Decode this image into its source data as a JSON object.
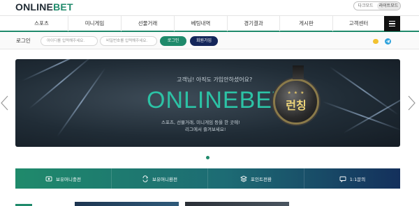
{
  "header": {
    "logo_main": "ONLINE",
    "logo_accent": "BET",
    "mode_dark": "다크모드",
    "mode_light": "라이트모드"
  },
  "nav": {
    "items": [
      {
        "label": "스포츠"
      },
      {
        "label": "미니게임"
      },
      {
        "label": "선물거래"
      },
      {
        "label": "베팅내역"
      },
      {
        "label": "경기결과"
      },
      {
        "label": "게시판"
      },
      {
        "label": "고객센터"
      }
    ]
  },
  "login": {
    "label": "로그인",
    "id_placeholder": "아이디를 입력해주세요.",
    "pw_placeholder": "비밀번호를 입력해주세요.",
    "login_button": "로그인",
    "join_button": "회원가입"
  },
  "banner": {
    "subtitle": "고객님! 아직도 가입안하셨어요?",
    "brand": "ONLINEBET",
    "desc_line1": "스포츠, 선물거래, 미니게임 등을 한 곳에!",
    "desc_line2": "리그에서 즐겨보세요!",
    "medal_text": "런칭",
    "medal_stars": "★ ★ ★"
  },
  "quick_menu": [
    {
      "label": "보유머니충전",
      "icon": "deposit-icon"
    },
    {
      "label": "보유머니환전",
      "icon": "exchange-icon"
    },
    {
      "label": "포인트전환",
      "icon": "point-convert-icon"
    },
    {
      "label": "1:1문의",
      "icon": "inquiry-icon"
    }
  ],
  "colors": {
    "accent": "#1f8a6b",
    "navy": "#14265a",
    "banner_brand": "#2cc2a5"
  }
}
